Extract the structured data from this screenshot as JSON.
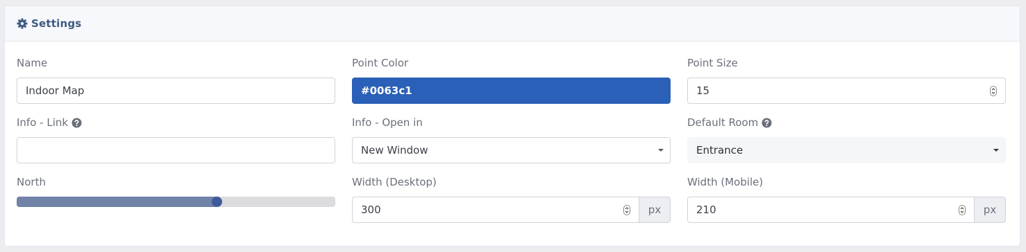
{
  "header": {
    "title": "Settings",
    "icon": "gear-icon"
  },
  "fields": {
    "name": {
      "label": "Name",
      "value": "Indoor Map"
    },
    "point_color": {
      "label": "Point Color",
      "value": "#0063c1"
    },
    "point_size": {
      "label": "Point Size",
      "value": "15"
    },
    "info_link": {
      "label": "Info - Link",
      "value": ""
    },
    "info_open_in": {
      "label": "Info - Open in",
      "value": "New Window"
    },
    "default_room": {
      "label": "Default Room",
      "value": "Entrance"
    },
    "north": {
      "label": "North",
      "slider_fraction": 0.63
    },
    "width_desktop": {
      "label": "Width (Desktop)",
      "value": "300",
      "unit": "px"
    },
    "width_mobile": {
      "label": "Width (Mobile)",
      "value": "210",
      "unit": "px"
    }
  },
  "colors": {
    "accent": "#3d5a80",
    "point_color_bg": "#2a60b7"
  }
}
